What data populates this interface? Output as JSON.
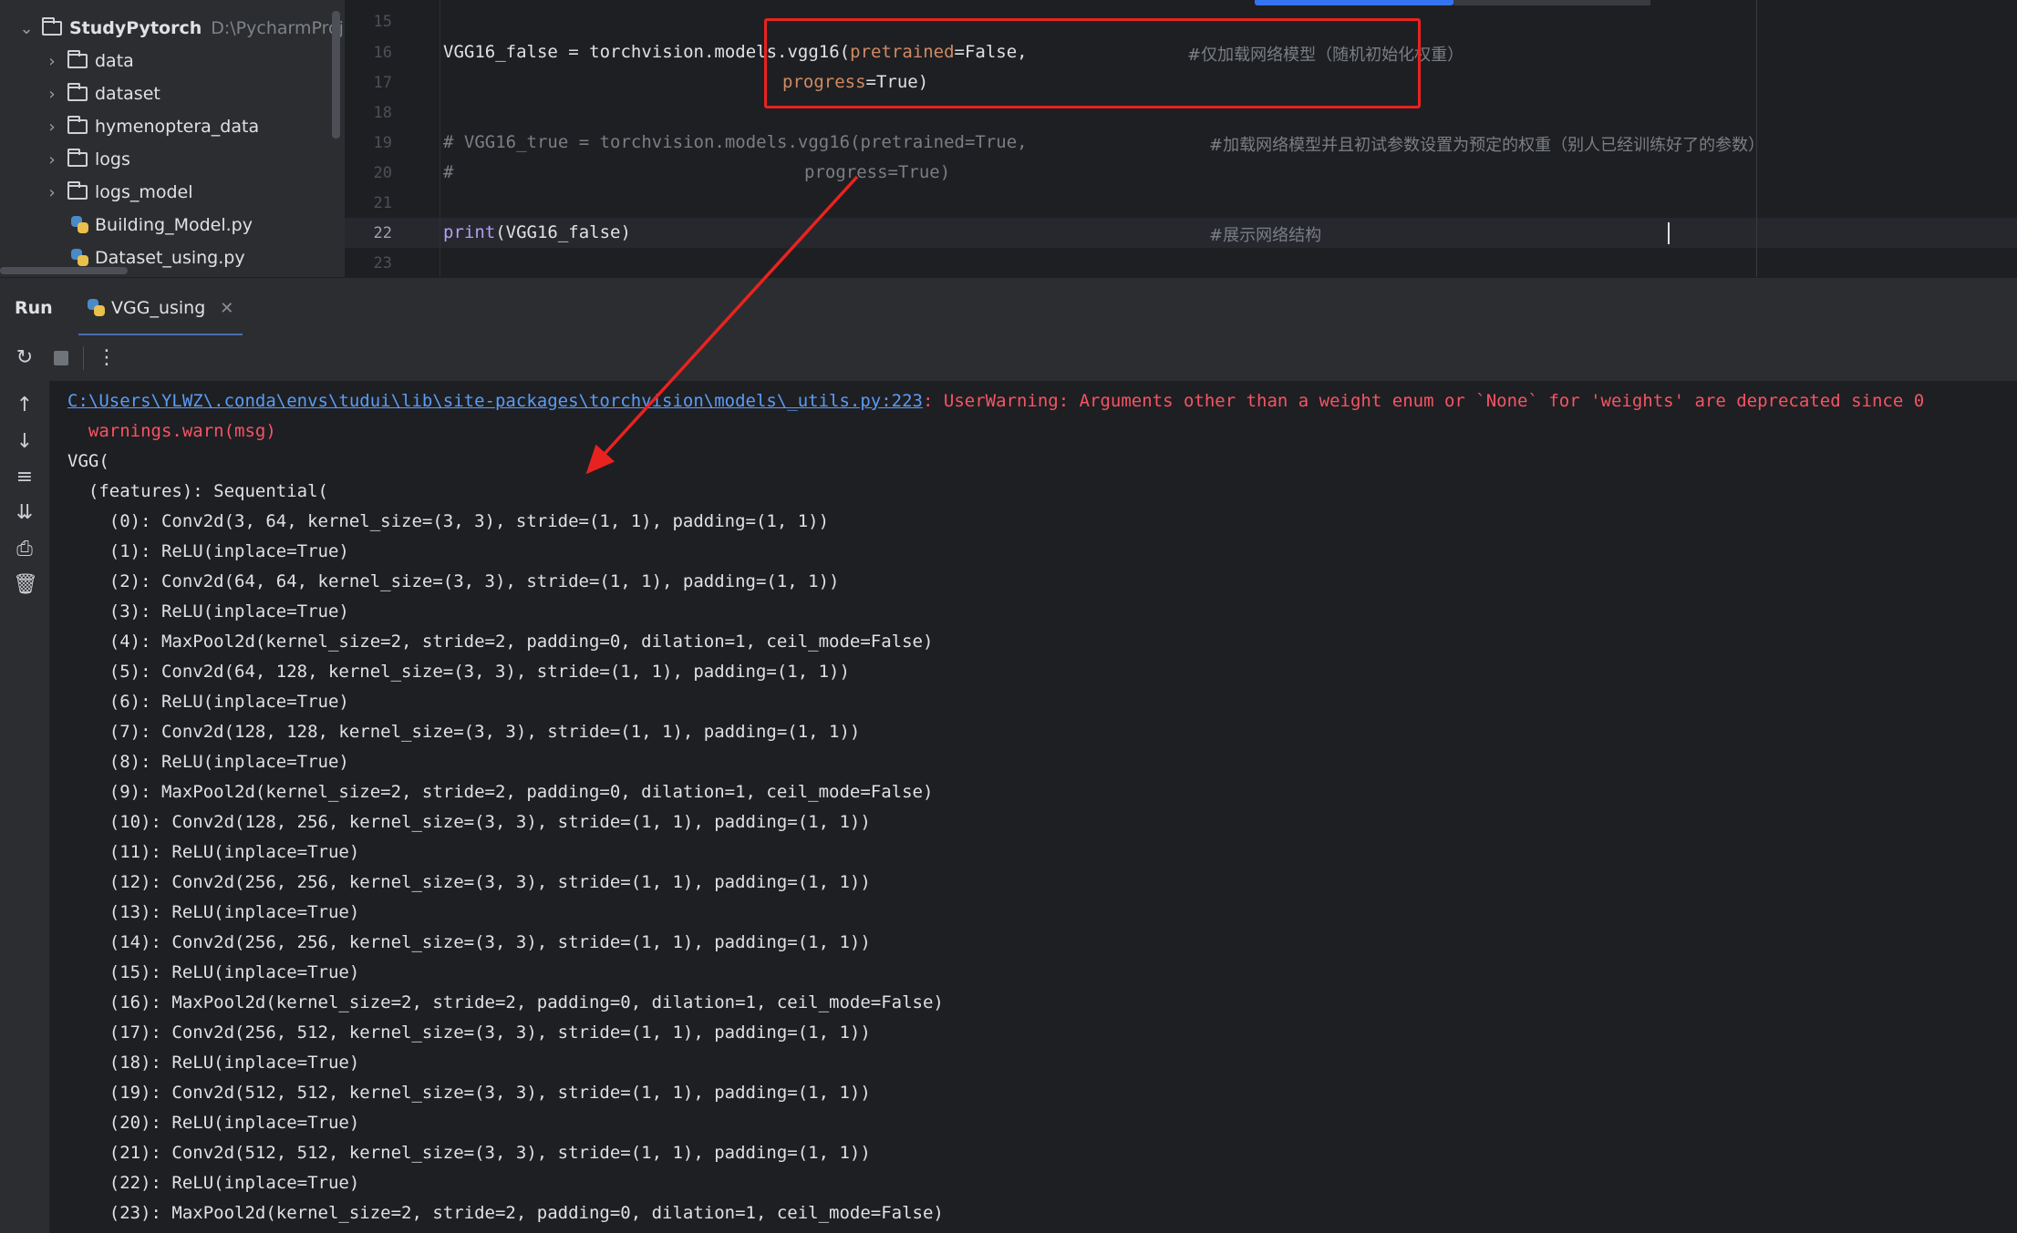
{
  "project_tree": {
    "root_name": "StudyPytorch",
    "root_path": "D:\\PycharmProjects",
    "items": [
      {
        "label": "data",
        "type": "folder"
      },
      {
        "label": "dataset",
        "type": "folder"
      },
      {
        "label": "hymenoptera_data",
        "type": "folder"
      },
      {
        "label": "logs",
        "type": "folder"
      },
      {
        "label": "logs_model",
        "type": "folder"
      },
      {
        "label": "Building_Model.py",
        "type": "python-file"
      },
      {
        "label": "Dataset_using.py",
        "type": "python-file"
      }
    ]
  },
  "editor": {
    "line_numbers": [
      "15",
      "16",
      "17",
      "18",
      "19",
      "20",
      "21",
      "22",
      "23"
    ],
    "current_line": "22",
    "code": {
      "l16_a": "VGG16_false = torchvision.models.vgg16(",
      "l16_kw": "pretrained",
      "l16_b": "=False,",
      "l16_comment": "#仅加载网络模型（随机初始化权重）",
      "l17_kw": "progress",
      "l17_b": "=True)",
      "l19": "# VGG16_true = torchvision.models.vgg16(pretrained=True,",
      "l19_comment": "#加载网络模型并且初试参数设置为预定的权重（别人已经训练好了的参数）",
      "l20_a": "#",
      "l20_b": "progress=True)",
      "l22_fn": "print",
      "l22_b": "(VGG16_false)",
      "l22_comment": "#展示网络结构"
    },
    "highlight_color": "#e8231f"
  },
  "run_panel": {
    "title": "Run",
    "tab_label": "VGG_using",
    "toolbar_icons": [
      "rerun-icon",
      "stop-icon",
      "more-icon"
    ],
    "sidebar_icons": [
      "scroll-up-icon",
      "scroll-down-icon",
      "soft-wrap-icon",
      "scroll-to-end-icon",
      "print-icon",
      "trash-icon"
    ]
  },
  "console": {
    "warning_path": "C:\\Users\\YLWZ\\.conda\\envs\\tudui\\lib\\site-packages\\torchvision\\models\\_utils.py:223",
    "warning_text": ": UserWarning: Arguments other than a weight enum or `None` for 'weights' are deprecated since 0",
    "warn_call": "  warnings.warn(msg)",
    "lines": [
      "VGG(",
      "  (features): Sequential(",
      "    (0): Conv2d(3, 64, kernel_size=(3, 3), stride=(1, 1), padding=(1, 1))",
      "    (1): ReLU(inplace=True)",
      "    (2): Conv2d(64, 64, kernel_size=(3, 3), stride=(1, 1), padding=(1, 1))",
      "    (3): ReLU(inplace=True)",
      "    (4): MaxPool2d(kernel_size=2, stride=2, padding=0, dilation=1, ceil_mode=False)",
      "    (5): Conv2d(64, 128, kernel_size=(3, 3), stride=(1, 1), padding=(1, 1))",
      "    (6): ReLU(inplace=True)",
      "    (7): Conv2d(128, 128, kernel_size=(3, 3), stride=(1, 1), padding=(1, 1))",
      "    (8): ReLU(inplace=True)",
      "    (9): MaxPool2d(kernel_size=2, stride=2, padding=0, dilation=1, ceil_mode=False)",
      "    (10): Conv2d(128, 256, kernel_size=(3, 3), stride=(1, 1), padding=(1, 1))",
      "    (11): ReLU(inplace=True)",
      "    (12): Conv2d(256, 256, kernel_size=(3, 3), stride=(1, 1), padding=(1, 1))",
      "    (13): ReLU(inplace=True)",
      "    (14): Conv2d(256, 256, kernel_size=(3, 3), stride=(1, 1), padding=(1, 1))",
      "    (15): ReLU(inplace=True)",
      "    (16): MaxPool2d(kernel_size=2, stride=2, padding=0, dilation=1, ceil_mode=False)",
      "    (17): Conv2d(256, 512, kernel_size=(3, 3), stride=(1, 1), padding=(1, 1))",
      "    (18): ReLU(inplace=True)",
      "    (19): Conv2d(512, 512, kernel_size=(3, 3), stride=(1, 1), padding=(1, 1))",
      "    (20): ReLU(inplace=True)",
      "    (21): Conv2d(512, 512, kernel_size=(3, 3), stride=(1, 1), padding=(1, 1))",
      "    (22): ReLU(inplace=True)",
      "    (23): MaxPool2d(kernel_size=2, stride=2, padding=0, dilation=1, ceil_mode=False)"
    ]
  },
  "colors": {
    "editor_bg": "#1e1f22",
    "panel_bg": "#2b2d30",
    "link": "#5a9cf8",
    "warning": "#f75464",
    "keyword_param": "#d08b63",
    "builtin": "#b39df3",
    "annotation_red": "#e8231f"
  }
}
